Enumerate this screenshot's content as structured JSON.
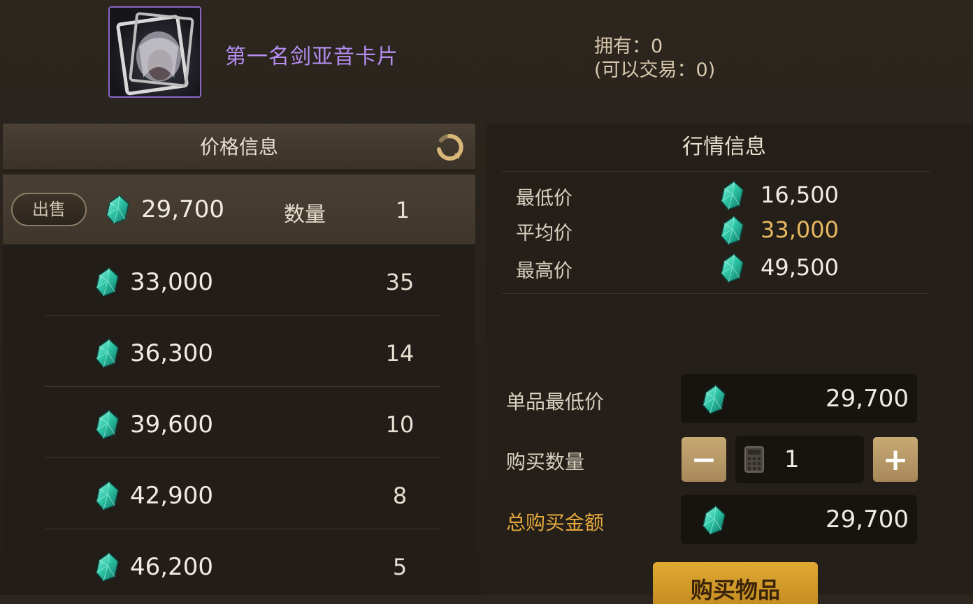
{
  "item": {
    "name": "第一名剑亚音卡片",
    "own_label": "拥有：0",
    "tradeable_label": "(可以交易：0)"
  },
  "price_panel": {
    "title": "价格信息",
    "sell_button": "出售",
    "qty_label": "数量",
    "rows": [
      {
        "price": "29,700",
        "qty": "1"
      },
      {
        "price": "33,000",
        "qty": "35"
      },
      {
        "price": "36,300",
        "qty": "14"
      },
      {
        "price": "39,600",
        "qty": "10"
      },
      {
        "price": "42,900",
        "qty": "8"
      },
      {
        "price": "46,200",
        "qty": "5"
      }
    ]
  },
  "market_panel": {
    "title": "行情信息",
    "stats": [
      {
        "label": "最低价",
        "value": "16,500"
      },
      {
        "label": "平均价",
        "value": "33,000"
      },
      {
        "label": "最高价",
        "value": "49,500"
      }
    ]
  },
  "purchase": {
    "unit_min_label": "单品最低价",
    "unit_min_value": "29,700",
    "qty_label": "购买数量",
    "qty_value": "1",
    "minus": "−",
    "plus": "+",
    "total_label": "总购买金额",
    "total_value": "29,700",
    "buy_button": "购买物品"
  },
  "colors": {
    "gem": "#2fc7a8",
    "accent_gold": "#e9b962",
    "item_name_purple": "#b58ef0"
  }
}
